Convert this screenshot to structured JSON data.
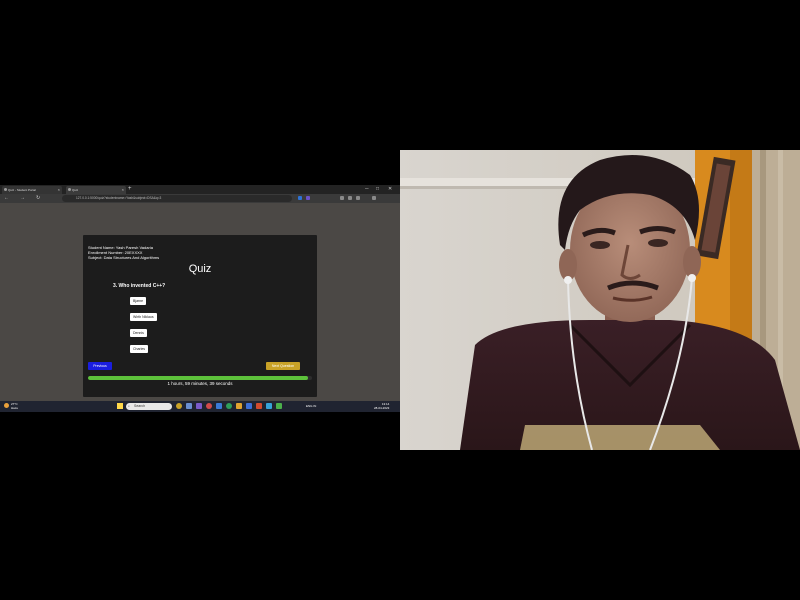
{
  "browser": {
    "tabs": [
      {
        "label": "Quiz - Student Portal"
      },
      {
        "label": "Quiz"
      }
    ],
    "address_bar": "127.0.0.1:5000/quiz?studentname=Yash&subject=DSA&q=3",
    "window_controls": {
      "minimize": "─",
      "maximize": "□",
      "close": "✕"
    }
  },
  "quiz": {
    "student_name": "Student Name: Yash Paresh Vadaria",
    "enrollment": "Enrollment Number: 20EXXXX",
    "subject": "Subject: Data Structures And Algorithms",
    "title": "Quiz",
    "question": "3. Who invented C++?",
    "options": [
      "Bjarne",
      "Wirth Niklaus",
      "Dennis",
      "Charles"
    ],
    "prev_label": "Previous",
    "next_label": "Next Question",
    "progress_fraction": 0.98,
    "timer": "1 hours, 59 minutes, 39 seconds"
  },
  "taskbar": {
    "weather_temp": "27°C",
    "weather_desc": "Haze",
    "search_label": "Search",
    "tray": "ENG IN",
    "time": "13:14",
    "date": "28-04-2023"
  },
  "colors": {
    "accent_blue": "#1a1ee0",
    "accent_gold": "#c9a227",
    "progress_green": "#5dc23b"
  },
  "icons": [
    "search-icon",
    "windows-start-icon",
    "weather-icon",
    "back-icon",
    "forward-icon",
    "reload-icon"
  ]
}
